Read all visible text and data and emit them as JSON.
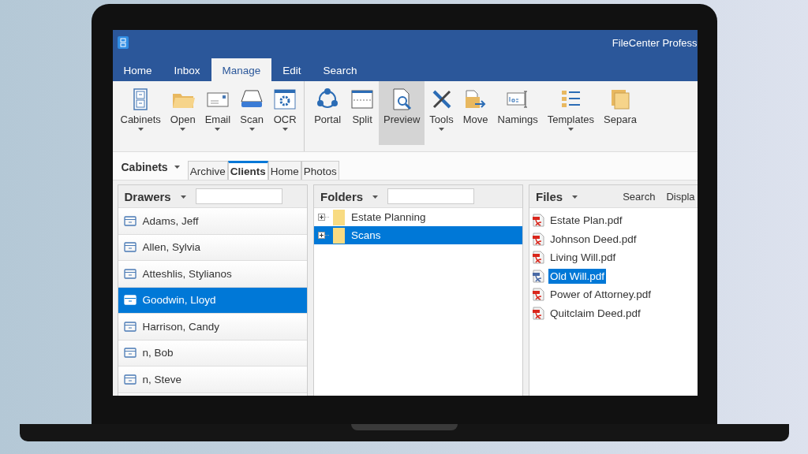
{
  "window": {
    "title": "FileCenter Profess"
  },
  "tabs": [
    {
      "label": "Home",
      "selected": false
    },
    {
      "label": "Inbox",
      "selected": false
    },
    {
      "label": "Manage",
      "selected": true
    },
    {
      "label": "Edit",
      "selected": false
    },
    {
      "label": "Search",
      "selected": false
    }
  ],
  "ribbon": {
    "groups": [
      [
        {
          "label": "Cabinets",
          "dropdown": true,
          "selected": false
        },
        {
          "label": "Open",
          "dropdown": true,
          "selected": false
        },
        {
          "label": "Email",
          "dropdown": true,
          "selected": false
        },
        {
          "label": "Scan",
          "dropdown": true,
          "selected": false
        },
        {
          "label": "OCR",
          "dropdown": true,
          "selected": false
        }
      ],
      [
        {
          "label": "Portal",
          "dropdown": false,
          "selected": false
        },
        {
          "label": "Split",
          "dropdown": false,
          "selected": false
        },
        {
          "label": "Preview",
          "dropdown": false,
          "selected": true
        },
        {
          "label": "Tools",
          "dropdown": true,
          "selected": false
        },
        {
          "label": "Move",
          "dropdown": false,
          "selected": false
        },
        {
          "label": "Namings",
          "dropdown": false,
          "selected": false
        },
        {
          "label": "Templates",
          "dropdown": true,
          "selected": false
        },
        {
          "label": "Separa",
          "dropdown": false,
          "selected": false
        }
      ]
    ]
  },
  "cabinets": {
    "label": "Cabinets",
    "tabs": [
      {
        "label": "Archive",
        "selected": false
      },
      {
        "label": "Clients",
        "selected": true
      },
      {
        "label": "Home",
        "selected": false
      },
      {
        "label": "Photos",
        "selected": false
      }
    ]
  },
  "drawers": {
    "title": "Drawers",
    "items": [
      {
        "label": "Adams, Jeff",
        "selected": false
      },
      {
        "label": "Allen, Sylvia",
        "selected": false
      },
      {
        "label": "Atteshlis, Stylianos",
        "selected": false
      },
      {
        "label": "Goodwin, Lloyd",
        "selected": true
      },
      {
        "label": "Harrison, Candy",
        "selected": false
      },
      {
        "label": "n, Bob",
        "selected": false
      },
      {
        "label": "n, Steve",
        "selected": false
      }
    ]
  },
  "folders": {
    "title": "Folders",
    "items": [
      {
        "label": "Estate Planning",
        "expanded": false,
        "selected": false
      },
      {
        "label": "Scans",
        "expanded": false,
        "selected": true
      }
    ]
  },
  "files": {
    "title": "Files",
    "actions": [
      "Search",
      "Displa"
    ],
    "items": [
      {
        "label": "Estate Plan.pdf",
        "selected": false
      },
      {
        "label": "Johnson Deed.pdf",
        "selected": false
      },
      {
        "label": "Living Will.pdf",
        "selected": false
      },
      {
        "label": "Old Will.pdf",
        "selected": true
      },
      {
        "label": "Power of Attorney.pdf",
        "selected": false
      },
      {
        "label": "Quitclaim Deed.pdf",
        "selected": false
      }
    ]
  }
}
